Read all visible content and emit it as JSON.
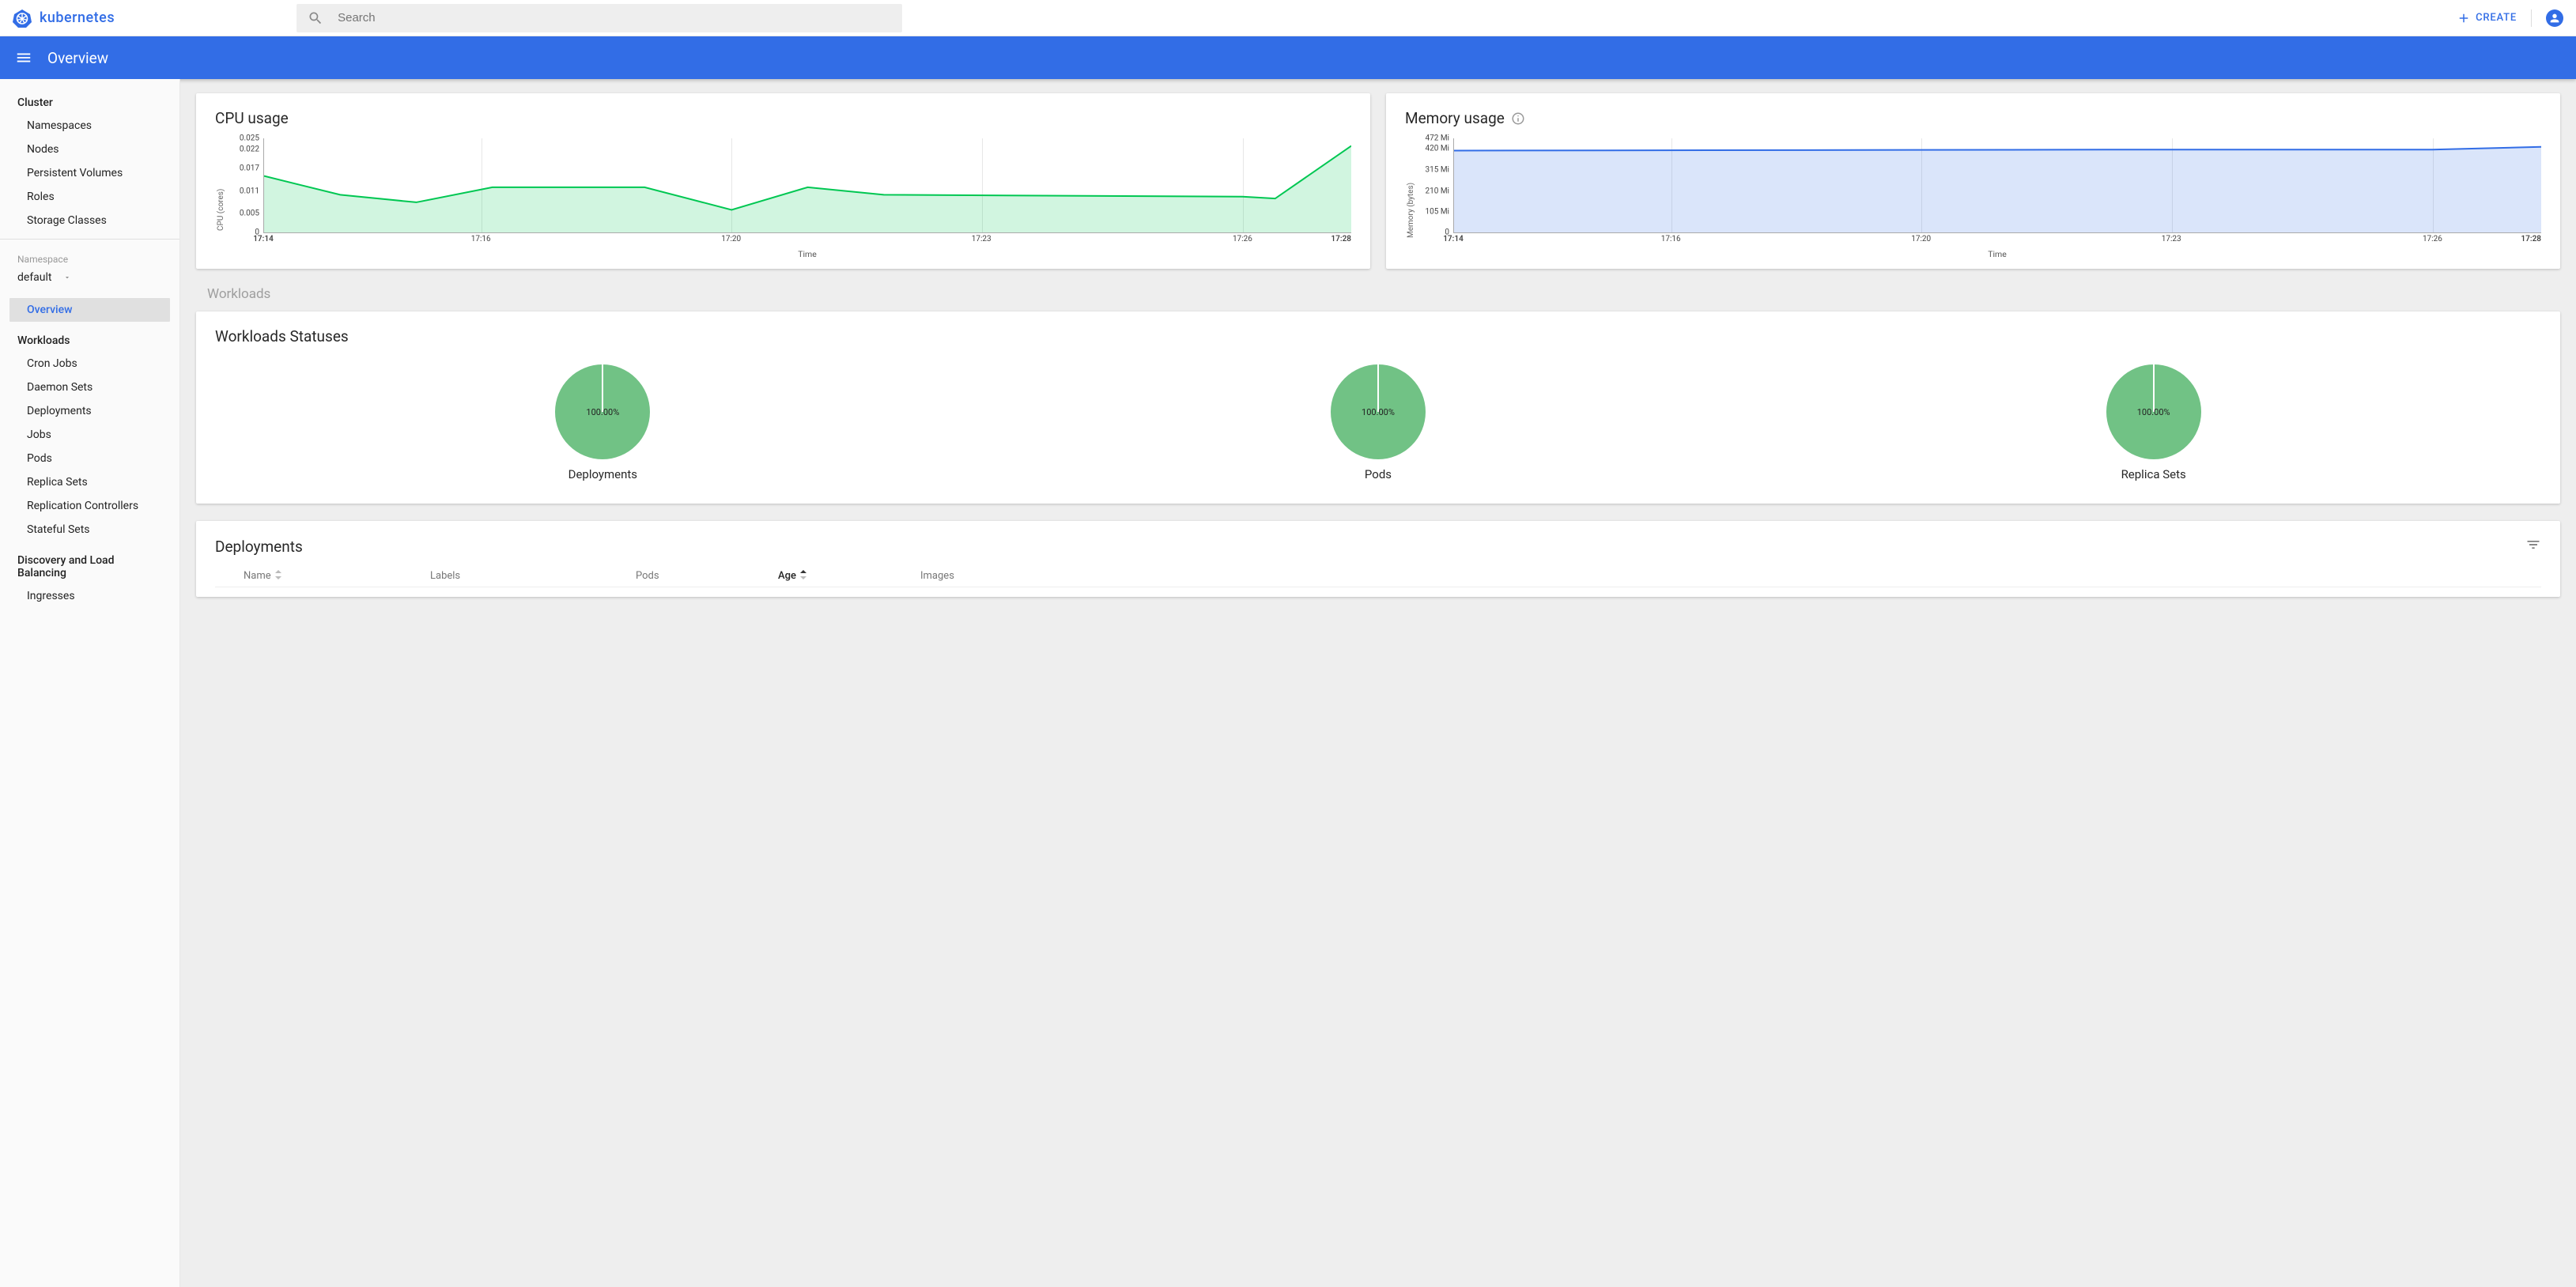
{
  "brand": {
    "name": "kubernetes"
  },
  "search": {
    "placeholder": "Search"
  },
  "topbar": {
    "create": "CREATE"
  },
  "bluebar": {
    "title": "Overview"
  },
  "sidebar": {
    "cluster_heading": "Cluster",
    "cluster_items": [
      "Namespaces",
      "Nodes",
      "Persistent Volumes",
      "Roles",
      "Storage Classes"
    ],
    "namespace_label": "Namespace",
    "namespace_value": "default",
    "overview": "Overview",
    "workloads_heading": "Workloads",
    "workloads_items": [
      "Cron Jobs",
      "Daemon Sets",
      "Deployments",
      "Jobs",
      "Pods",
      "Replica Sets",
      "Replication Controllers",
      "Stateful Sets"
    ],
    "dlb_heading": "Discovery and Load Balancing",
    "dlb_items": [
      "Ingresses"
    ]
  },
  "panels": {
    "cpu": {
      "title": "CPU usage"
    },
    "mem": {
      "title": "Memory usage"
    }
  },
  "chart_data": [
    {
      "type": "area",
      "title": "CPU usage",
      "ylabel": "CPU (cores)",
      "xlabel": "Time",
      "x": [
        "17:14",
        "17:16",
        "17:20",
        "17:23",
        "17:26",
        "17:28"
      ],
      "yticks": [
        0,
        0.005,
        0.011,
        0.017,
        0.022,
        0.025
      ],
      "ylim": [
        0,
        0.025
      ],
      "series": [
        {
          "name": "CPU",
          "color": "#00c752",
          "x": [
            "17:14",
            "17:15",
            "17:16",
            "17:17",
            "17:18",
            "17:20",
            "17:21",
            "17:22",
            "17:23",
            "17:24",
            "17:25",
            "17:26",
            "17:27",
            "17:28"
          ],
          "values": [
            0.015,
            0.01,
            0.008,
            0.012,
            0.012,
            0.006,
            0.012,
            0.01,
            0.01,
            0.01,
            0.01,
            0.009,
            0.009,
            0.023
          ]
        }
      ]
    },
    {
      "type": "area",
      "title": "Memory usage",
      "ylabel": "Memory (bytes)",
      "xlabel": "Time",
      "x": [
        "17:14",
        "17:16",
        "17:20",
        "17:23",
        "17:26",
        "17:28"
      ],
      "yticks": [
        "0",
        "105 Mi",
        "210 Mi",
        "315 Mi",
        "420 Mi",
        "472 Mi"
      ],
      "ylim": [
        0,
        472
      ],
      "series": [
        {
          "name": "Memory",
          "color": "#326de6",
          "x": [
            "17:14",
            "17:16",
            "17:20",
            "17:23",
            "17:26",
            "17:28"
          ],
          "values": [
            410,
            410,
            412,
            415,
            415,
            430
          ]
        }
      ]
    }
  ],
  "sections": {
    "workloads": "Workloads"
  },
  "workloads_statuses": {
    "title": "Workloads Statuses",
    "items": [
      {
        "label": "Deployments",
        "percent": "100.00%"
      },
      {
        "label": "Pods",
        "percent": "100.00%"
      },
      {
        "label": "Replica Sets",
        "percent": "100.00%"
      }
    ]
  },
  "deployments_table": {
    "title": "Deployments",
    "columns": {
      "name": "Name",
      "labels": "Labels",
      "pods": "Pods",
      "age": "Age",
      "images": "Images"
    }
  }
}
